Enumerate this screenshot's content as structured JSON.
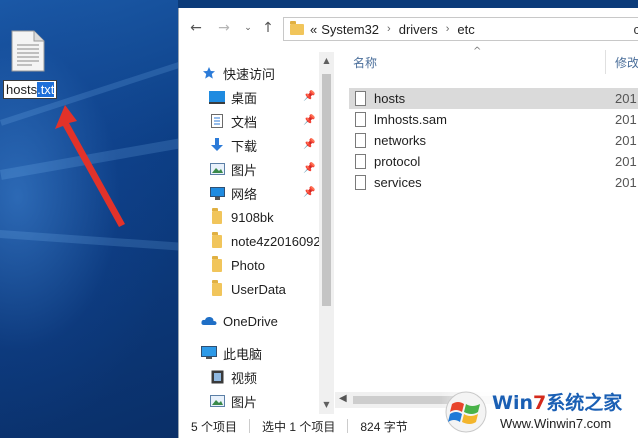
{
  "desktop": {
    "file_icon": "text-file-icon",
    "rename_base": "hosts",
    "rename_ext": ".txt"
  },
  "explorer": {
    "nav": {
      "back": "arrow-left-icon",
      "forward": "arrow-right-icon",
      "dropdown": "chevron-down-icon",
      "up": "arrow-up-icon"
    },
    "address": {
      "overflow": "«",
      "segments": [
        "System32",
        "drivers",
        "etc"
      ],
      "trail_char": "c"
    },
    "nav_pane": {
      "items": [
        {
          "label": "快速访问",
          "icon": "star-icon",
          "pinned": false
        },
        {
          "label": "桌面",
          "icon": "desktop-icon",
          "pinned": true
        },
        {
          "label": "文档",
          "icon": "document-icon",
          "pinned": true
        },
        {
          "label": "下载",
          "icon": "download-icon",
          "pinned": true
        },
        {
          "label": "图片",
          "icon": "pictures-icon",
          "pinned": true
        },
        {
          "label": "网络",
          "icon": "network-icon",
          "pinned": true
        },
        {
          "label": "9108bk",
          "icon": "folder-icon",
          "pinned": false
        },
        {
          "label": "note4z2016092",
          "icon": "folder-icon",
          "pinned": false
        },
        {
          "label": "Photo",
          "icon": "folder-icon",
          "pinned": false
        },
        {
          "label": "UserData",
          "icon": "folder-icon",
          "pinned": false
        },
        {
          "label": "OneDrive",
          "icon": "cloud-icon",
          "pinned": false
        },
        {
          "label": "此电脑",
          "icon": "computer-icon",
          "pinned": false
        },
        {
          "label": "视频",
          "icon": "video-icon",
          "pinned": false
        },
        {
          "label": "图片",
          "icon": "pictures-icon",
          "pinned": false
        }
      ]
    },
    "columns": {
      "name": "名称",
      "modified": "修改"
    },
    "files": [
      {
        "name": "hosts",
        "date": "201",
        "selected": true
      },
      {
        "name": "lmhosts.sam",
        "date": "201",
        "selected": false
      },
      {
        "name": "networks",
        "date": "201",
        "selected": false
      },
      {
        "name": "protocol",
        "date": "201",
        "selected": false
      },
      {
        "name": "services",
        "date": "201",
        "selected": false
      }
    ],
    "status": {
      "count": "5 个项目",
      "selection": "选中 1 个项目",
      "size": "824 字节"
    }
  },
  "watermark": {
    "title_a": "Win",
    "title_b": "7",
    "title_c": "系统之家",
    "url": "Www.Winwin7.com",
    "colors": {
      "blue": "#1a5fb4",
      "red": "#d42a1c"
    }
  },
  "colors": {
    "selection": "#1e6fd9",
    "arrow": "#e2322a",
    "row_selected": "#dadada"
  }
}
